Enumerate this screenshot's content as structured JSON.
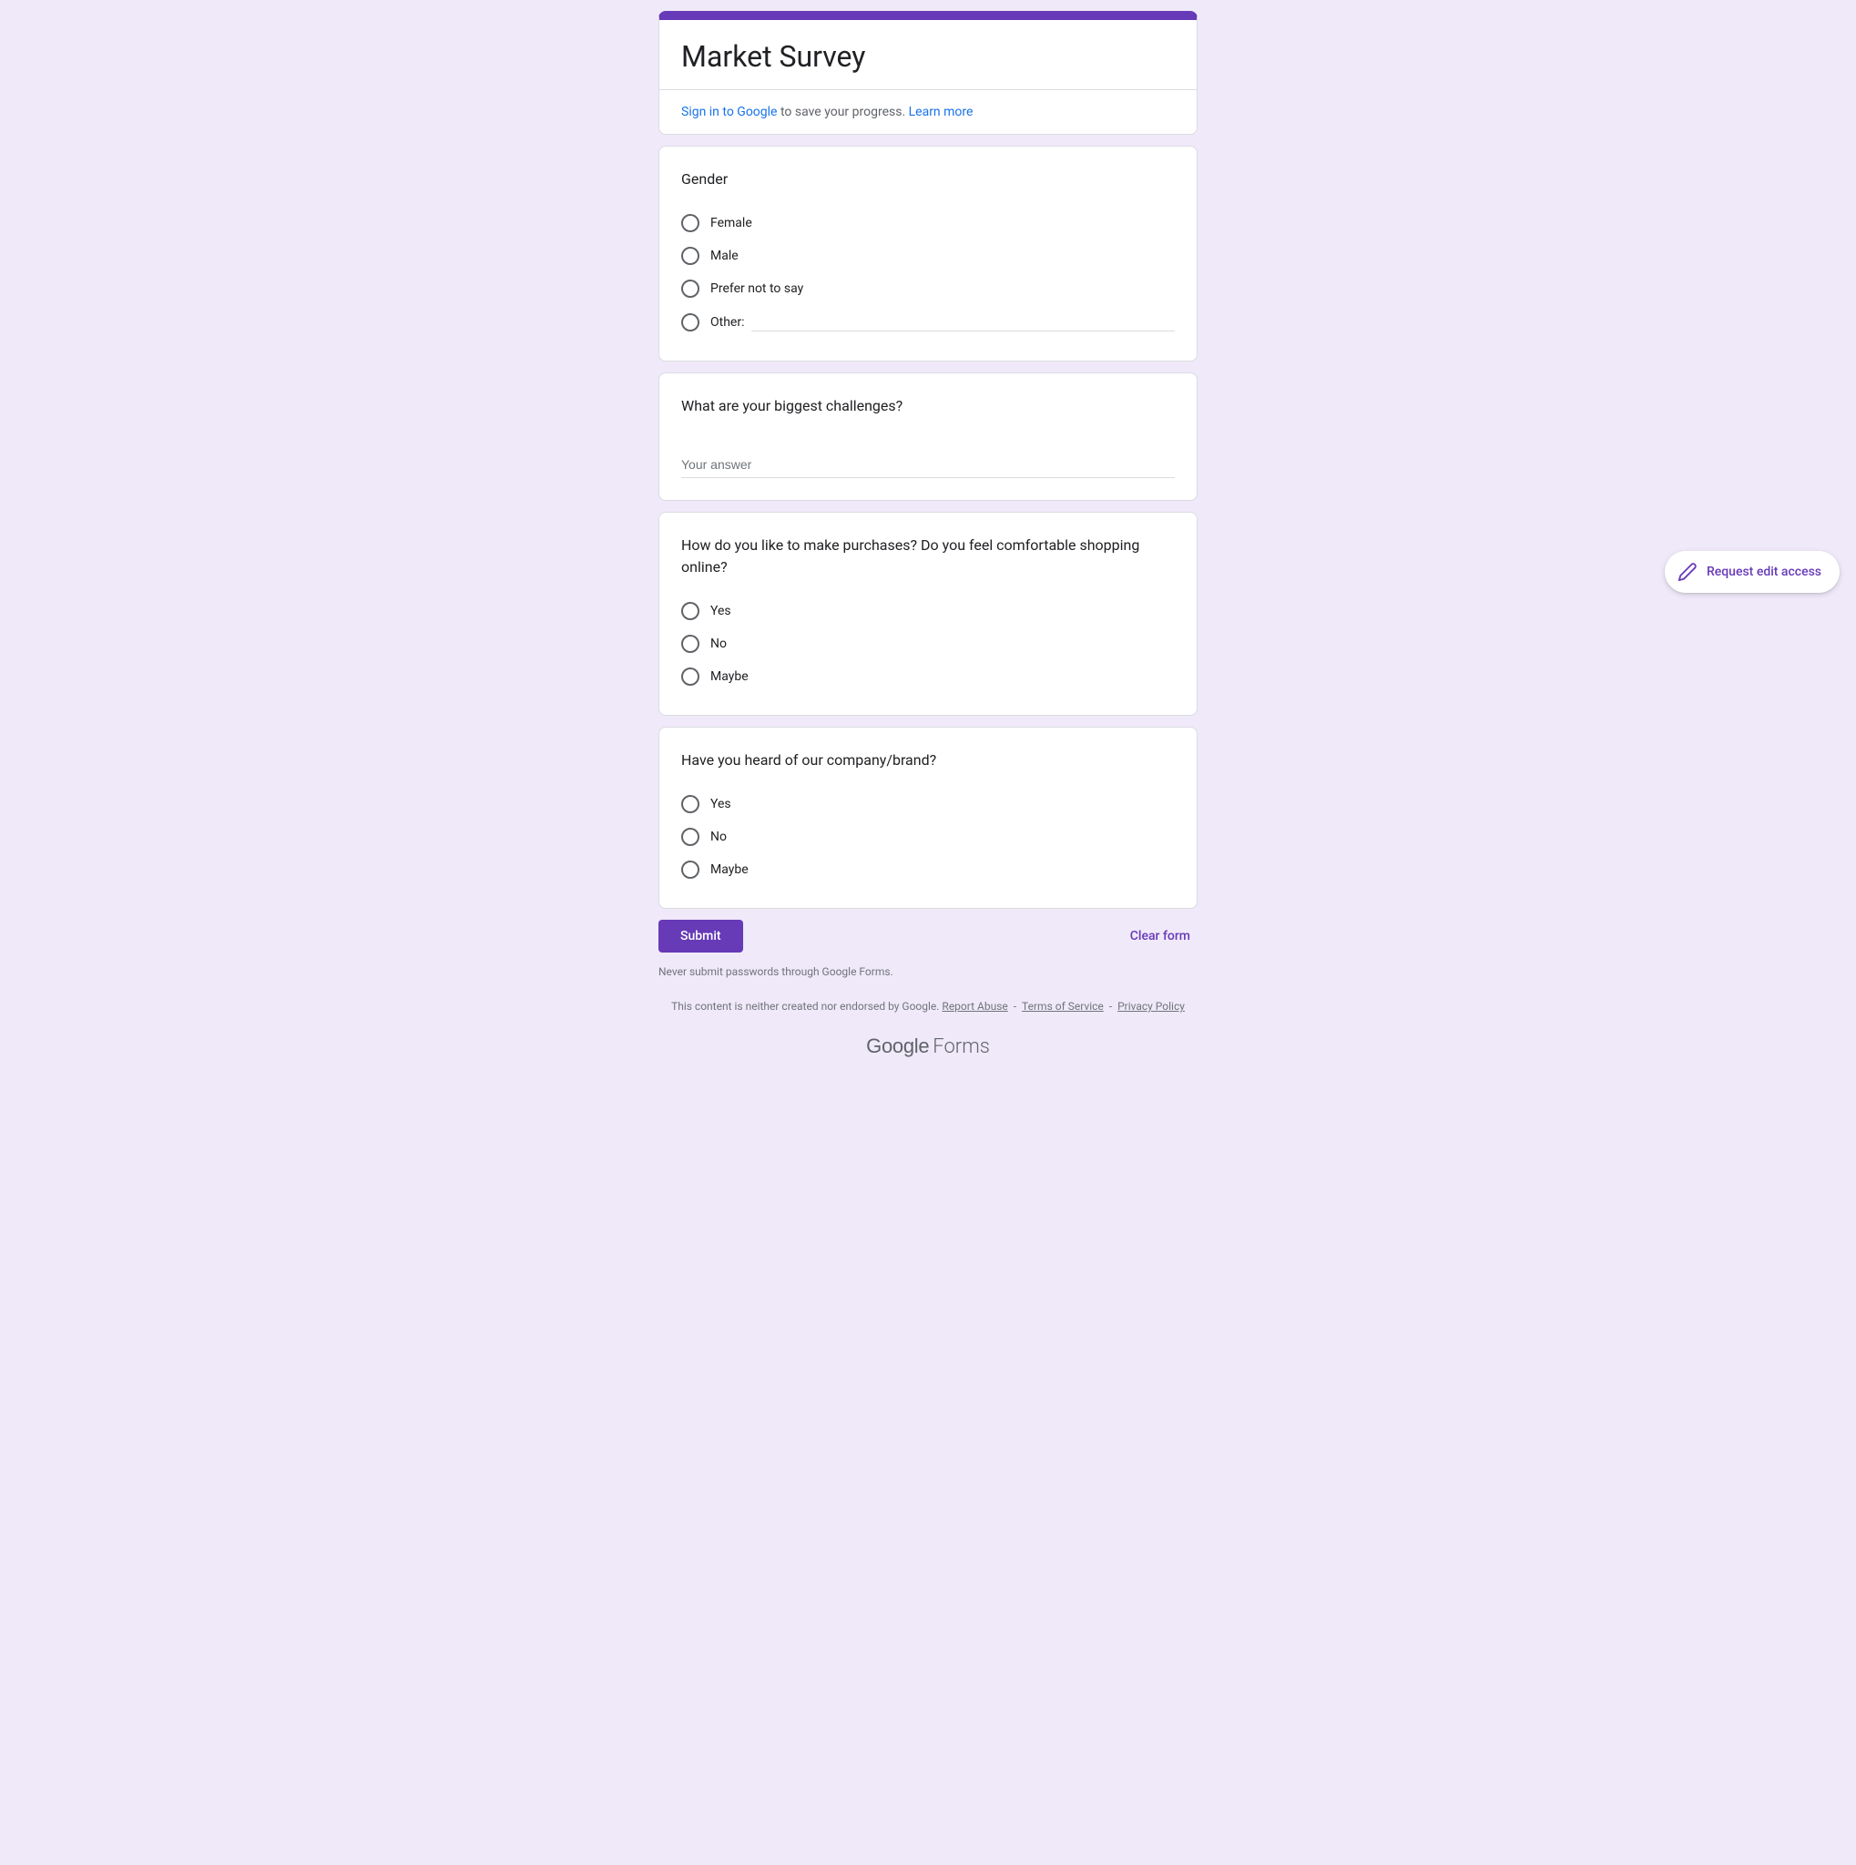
{
  "header": {
    "title": "Market Survey",
    "signin_prefix": "Sign in to Google",
    "signin_text": " to save your progress. ",
    "learn_more": "Learn more"
  },
  "questions": [
    {
      "title": "Gender",
      "type": "radio",
      "options": [
        "Female",
        "Male",
        "Prefer not to say"
      ],
      "other_label": "Other:"
    },
    {
      "title": "What are your biggest challenges?",
      "type": "text",
      "placeholder": "Your answer"
    },
    {
      "title": "How do you like to make purchases? Do you feel comfortable shopping online?",
      "type": "radio",
      "options": [
        "Yes",
        "No",
        "Maybe"
      ]
    },
    {
      "title": "Have you heard of our company/brand?",
      "type": "radio",
      "options": [
        "Yes",
        "No",
        "Maybe"
      ]
    }
  ],
  "actions": {
    "submit": "Submit",
    "clear": "Clear form"
  },
  "warning": "Never submit passwords through Google Forms.",
  "footer": {
    "disclaimer": "This content is neither created nor endorsed by Google. ",
    "report_abuse": "Report Abuse",
    "terms": "Terms of Service",
    "privacy": "Privacy Policy"
  },
  "logo": {
    "google": "Google",
    "forms": "Forms"
  },
  "floating": {
    "request_edit": "Request edit access"
  }
}
